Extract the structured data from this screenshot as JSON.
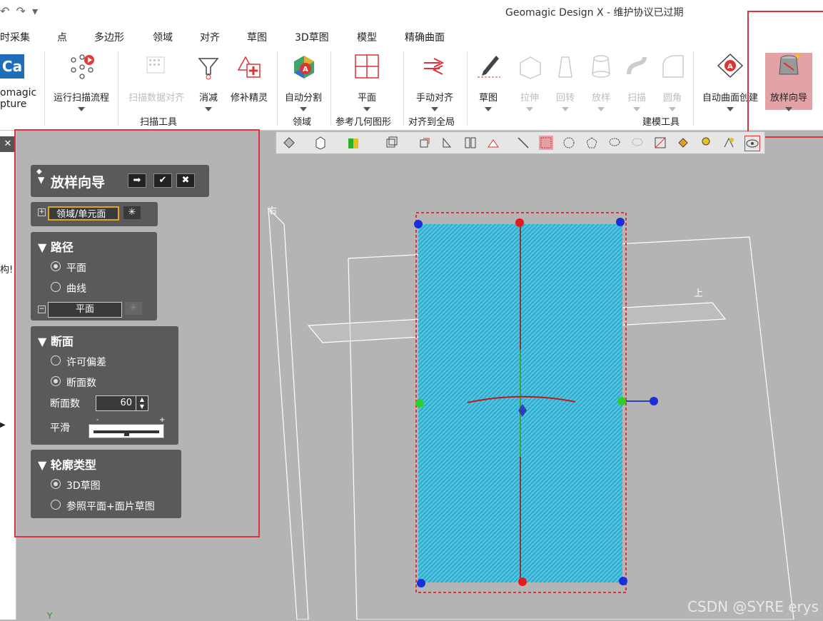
{
  "window": {
    "title": "Geomagic Design X - 维护协议已过期"
  },
  "menu": [
    "时采集",
    "点",
    "多边形",
    "领域",
    "对齐",
    "草图",
    "3D草图",
    "模型",
    "精确曲面"
  ],
  "ribbon": {
    "left_app": {
      "line1": "omagic",
      "line2": "pture"
    },
    "buttons": [
      {
        "label": "运行扫描流程",
        "dim": false
      },
      {
        "label": "扫描数据对齐",
        "dim": true
      },
      {
        "label": "消减",
        "dim": false
      },
      {
        "label": "修补精灵",
        "dim": false
      },
      {
        "label": "自动分割",
        "dim": false
      },
      {
        "label": "平面",
        "dim": false
      },
      {
        "label": "手动对齐",
        "dim": false
      },
      {
        "label": "草图",
        "dim": false
      },
      {
        "label": "拉伸",
        "dim": true
      },
      {
        "label": "回转",
        "dim": true
      },
      {
        "label": "放样",
        "dim": true
      },
      {
        "label": "扫描",
        "dim": true
      },
      {
        "label": "圆角",
        "dim": true
      },
      {
        "label": "自动曲面创建",
        "dim": false
      },
      {
        "label": "放样向导",
        "dim": false
      }
    ],
    "groups": [
      "扫描工具",
      "领域",
      "参考几何图形",
      "对齐到全局",
      "建模工具"
    ]
  },
  "left_strip": {
    "text": "构!"
  },
  "wizard": {
    "title": "放样向导",
    "region_label": "领域/单元面",
    "path": {
      "header": "路径",
      "options": [
        "平面",
        "曲线"
      ],
      "selected": 0,
      "field": "平面"
    },
    "section": {
      "header": "断面",
      "options": [
        "许可偏差",
        "断面数"
      ],
      "selected": 1,
      "count_label": "断面数",
      "count_value": "60",
      "smooth_label": "平滑",
      "smooth_minus": "-",
      "smooth_plus": "+",
      "smooth_level": 0.5
    },
    "profile": {
      "header": "轮廓类型",
      "options": [
        "3D草图",
        "参照平面+面片草图"
      ],
      "selected": 0
    }
  },
  "viewport": {
    "label_top": "上",
    "label_right": "右",
    "axis_y": "Y"
  },
  "watermark": "CSDN @SYRE erys",
  "colors": {
    "accent_red": "#d9333f",
    "mesh_cyan": "#4cc4e4",
    "panel_gray": "#5a5a5a"
  }
}
